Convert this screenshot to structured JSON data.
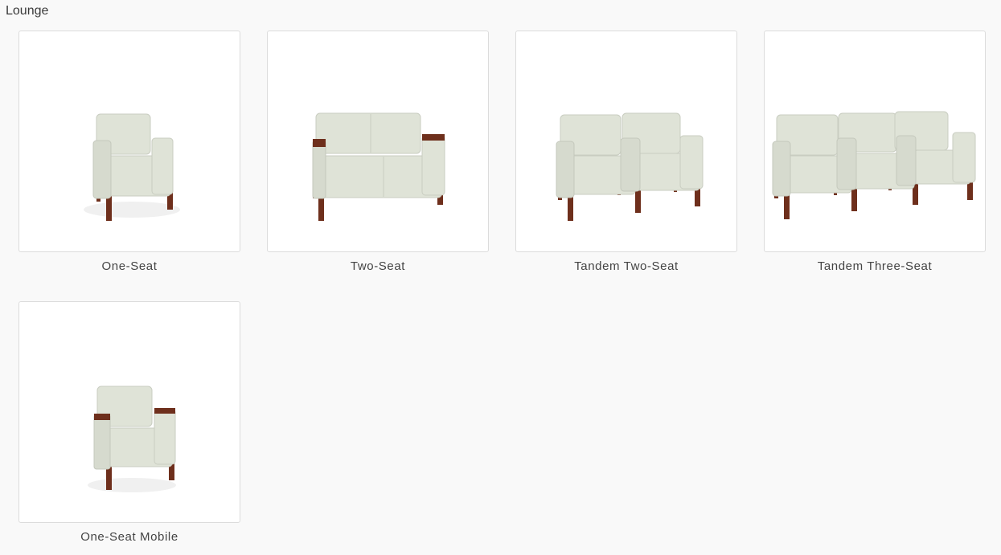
{
  "section": {
    "title": "Lounge"
  },
  "colors": {
    "upholstery": "#dfe3d7",
    "upholstery_shade": "#c9cdc1",
    "upholstery_light": "#eceee6",
    "wood": "#6e2f1c",
    "card_border": "#dcdcdc",
    "page_bg": "#f9f9f9"
  },
  "products": [
    {
      "label": "One-Seat",
      "icon": "one-seat-chair-icon"
    },
    {
      "label": "Two-Seat",
      "icon": "two-seat-sofa-icon"
    },
    {
      "label": "Tandem Two-Seat",
      "icon": "tandem-two-seat-icon"
    },
    {
      "label": "Tandem Three-Seat",
      "icon": "tandem-three-seat-icon"
    },
    {
      "label": "One-Seat Mobile",
      "icon": "one-seat-mobile-chair-icon"
    }
  ]
}
